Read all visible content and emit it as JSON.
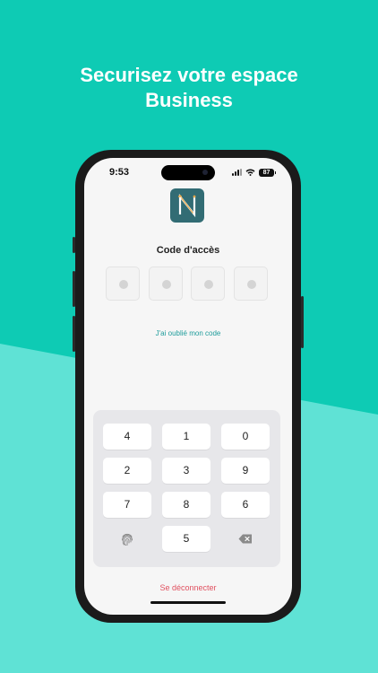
{
  "colors": {
    "background_top": "#0ecbb4",
    "background_bottom": "#5fe2d5",
    "accent": "#1e9c9b",
    "danger": "#e0505f",
    "logo_bg": "#326c74",
    "logo_stroke": "#e9a84a"
  },
  "headline": {
    "line1": "Securisez votre espace",
    "line2": "Business"
  },
  "status_bar": {
    "time": "9:53",
    "battery": "87",
    "icons": [
      "signal-icon",
      "wifi-icon",
      "battery-icon"
    ]
  },
  "app": {
    "logo_icon": "app-logo-n-icon",
    "code_title": "Code d'accès",
    "pin_length": 4,
    "forgot_link": "J'ai oublié mon code",
    "keypad": {
      "rows": [
        [
          "4",
          "1",
          "0"
        ],
        [
          "2",
          "3",
          "9"
        ],
        [
          "7",
          "8",
          "6"
        ],
        [
          "fingerprint-icon",
          "5",
          "backspace-icon"
        ]
      ]
    },
    "logout_label": "Se déconnecter"
  }
}
